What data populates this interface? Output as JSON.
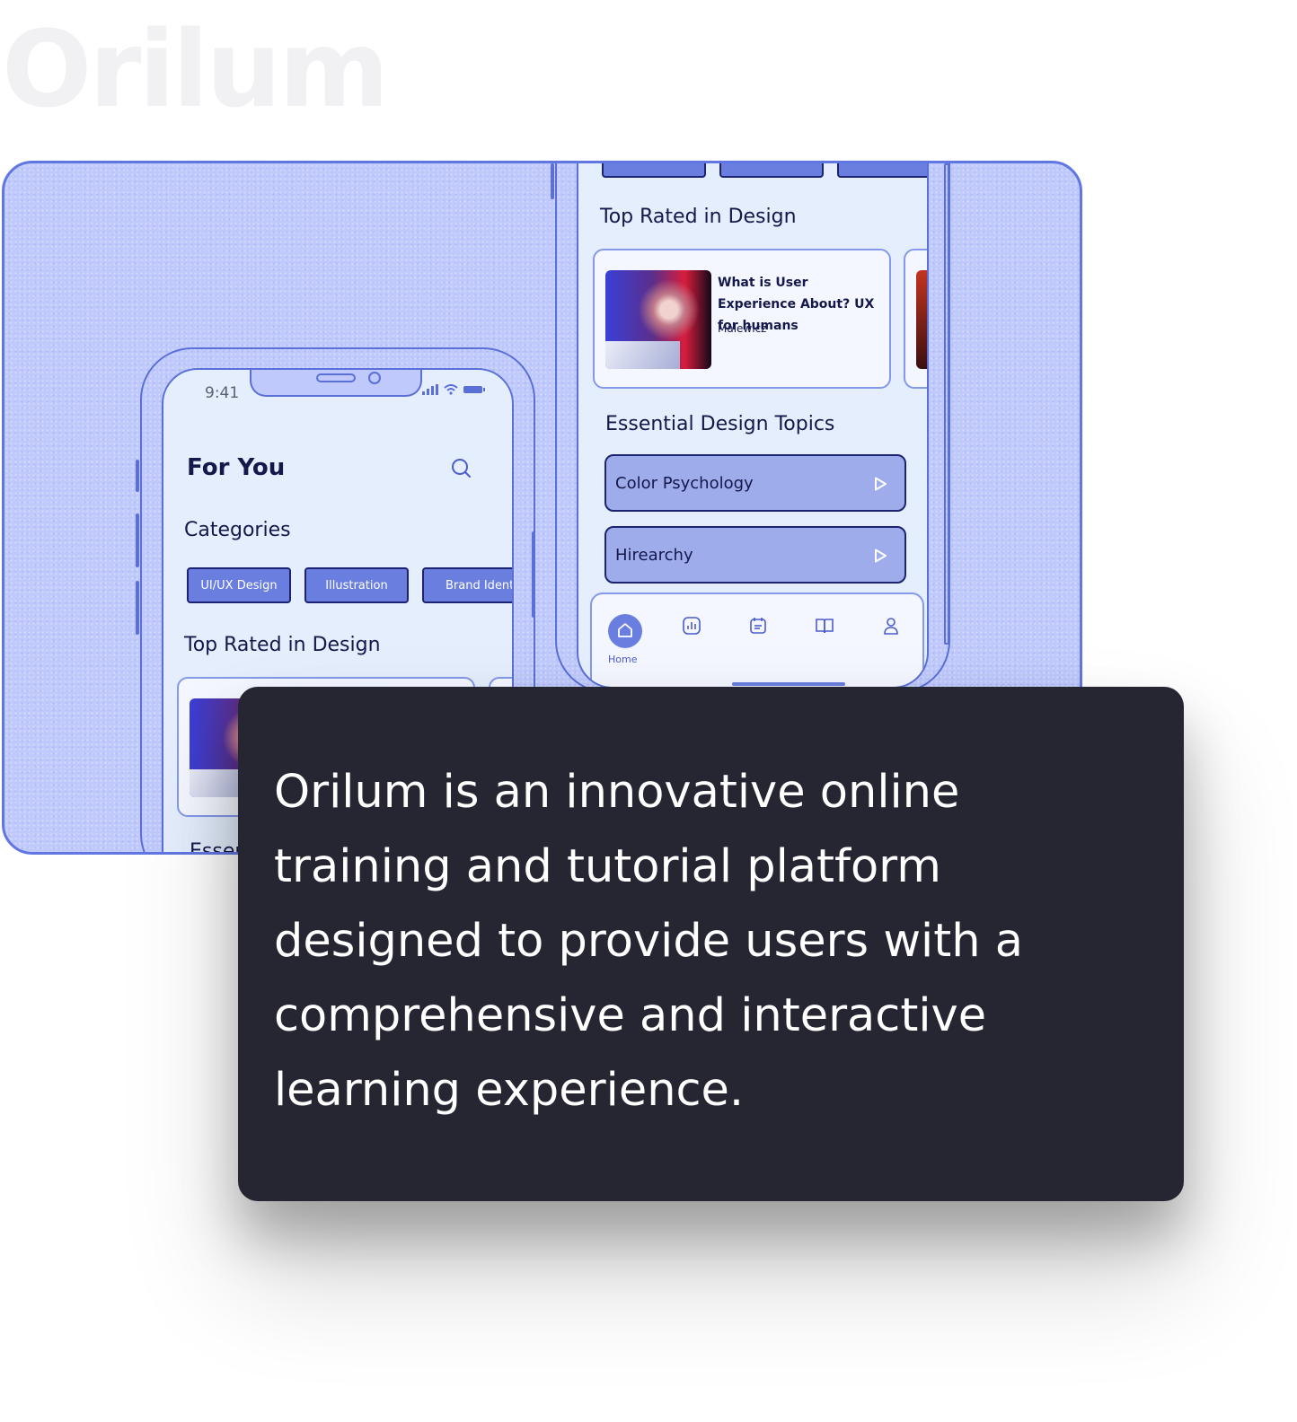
{
  "brand": {
    "name": "Orilum"
  },
  "left_phone": {
    "status_time": "9:41",
    "title": "For You",
    "categories_heading": "Categories",
    "categories": [
      "UI/UX Design",
      "Illustration",
      "Brand Ident"
    ],
    "top_rated_heading": "Top Rated in Design",
    "cut_heading": "Essen"
  },
  "right_phone": {
    "top_rated_heading": "Top Rated in Design",
    "featured_card": {
      "title": "What is User Experience About? UX for humans",
      "author": "Malewicz"
    },
    "essential_heading": "Essential Design Topics",
    "topics": [
      "Color Psychology",
      "Hirearchy"
    ],
    "tabbar": {
      "home_label": "Home"
    }
  },
  "description": {
    "text": "Orilum is an innovative online training and tutorial platform designed to provide users with a comprehensive and interactive learning experience."
  },
  "colors": {
    "accent": "#6a7ee0",
    "panel_bg": "#bfc9fb",
    "navy": "#14184a",
    "dark_card": "#262532"
  }
}
